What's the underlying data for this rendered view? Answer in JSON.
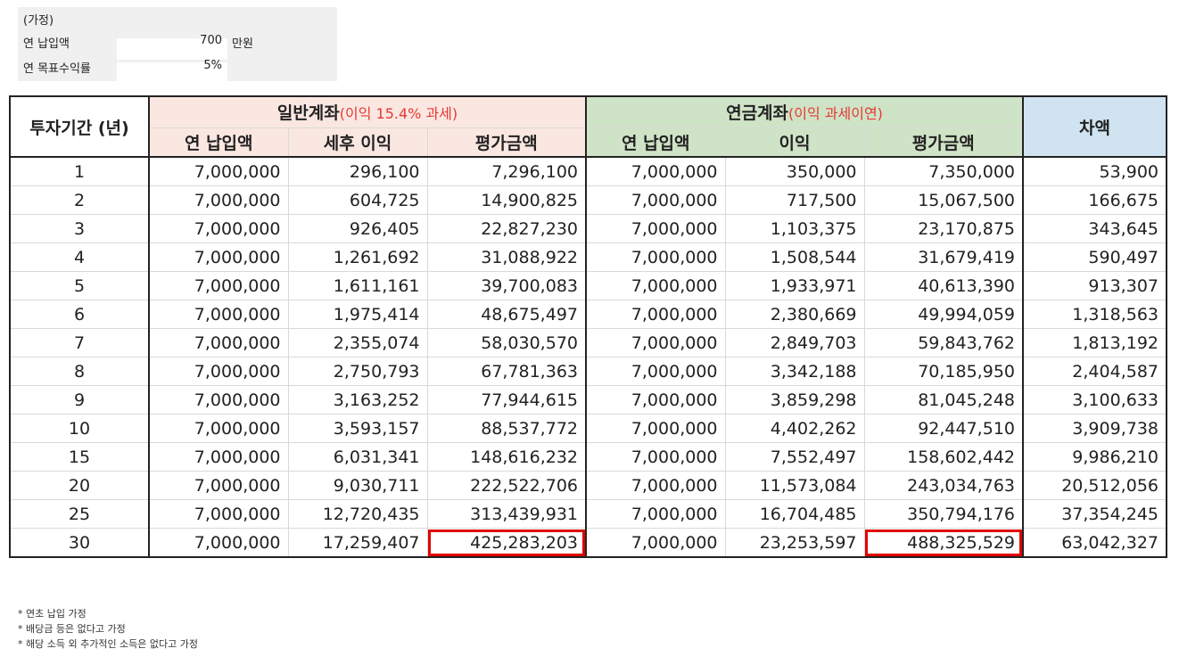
{
  "assumptions": {
    "title": "(가정)",
    "annual_payment_label": "연 납입액",
    "annual_payment_value": "700",
    "unit": "만원",
    "target_return_label": "연 목표수익률",
    "target_return_value": "5%"
  },
  "table": {
    "header_period": "투자기간 (년)",
    "general_title": "일반계좌",
    "general_note": "(이익 15.4% 과세)",
    "pension_title": "연금계좌",
    "pension_note": "(이익 과세이연)",
    "diff_title": "차액",
    "general_cols": [
      "연 납입액",
      "세후 이익",
      "평가금액"
    ],
    "pension_cols": [
      "연 납입액",
      "이익",
      "평가금액"
    ],
    "rows": [
      [
        "1",
        "7,000,000",
        "296,100",
        "7,296,100",
        "7,000,000",
        "350,000",
        "7,350,000",
        "53,900"
      ],
      [
        "2",
        "7,000,000",
        "604,725",
        "14,900,825",
        "7,000,000",
        "717,500",
        "15,067,500",
        "166,675"
      ],
      [
        "3",
        "7,000,000",
        "926,405",
        "22,827,230",
        "7,000,000",
        "1,103,375",
        "23,170,875",
        "343,645"
      ],
      [
        "4",
        "7,000,000",
        "1,261,692",
        "31,088,922",
        "7,000,000",
        "1,508,544",
        "31,679,419",
        "590,497"
      ],
      [
        "5",
        "7,000,000",
        "1,611,161",
        "39,700,083",
        "7,000,000",
        "1,933,971",
        "40,613,390",
        "913,307"
      ],
      [
        "6",
        "7,000,000",
        "1,975,414",
        "48,675,497",
        "7,000,000",
        "2,380,669",
        "49,994,059",
        "1,318,563"
      ],
      [
        "7",
        "7,000,000",
        "2,355,074",
        "58,030,570",
        "7,000,000",
        "2,849,703",
        "59,843,762",
        "1,813,192"
      ],
      [
        "8",
        "7,000,000",
        "2,750,793",
        "67,781,363",
        "7,000,000",
        "3,342,188",
        "70,185,950",
        "2,404,587"
      ],
      [
        "9",
        "7,000,000",
        "3,163,252",
        "77,944,615",
        "7,000,000",
        "3,859,298",
        "81,045,248",
        "3,100,633"
      ],
      [
        "10",
        "7,000,000",
        "3,593,157",
        "88,537,772",
        "7,000,000",
        "4,402,262",
        "92,447,510",
        "3,909,738"
      ],
      [
        "15",
        "7,000,000",
        "6,031,341",
        "148,616,232",
        "7,000,000",
        "7,552,497",
        "158,602,442",
        "9,986,210"
      ],
      [
        "20",
        "7,000,000",
        "9,030,711",
        "222,522,706",
        "7,000,000",
        "11,573,084",
        "243,034,763",
        "20,512,056"
      ],
      [
        "25",
        "7,000,000",
        "12,720,435",
        "313,439,931",
        "7,000,000",
        "16,704,485",
        "350,794,176",
        "37,354,245"
      ],
      [
        "30",
        "7,000,000",
        "17,259,407",
        "425,283,203",
        "7,000,000",
        "23,253,597",
        "488,325,529",
        "63,042,327"
      ]
    ],
    "highlight_row": 13,
    "highlight_cols": [
      3,
      6
    ],
    "highlight_color": "#e00000"
  },
  "notes": [
    "* 연초 납입 가정",
    "* 배당금 등은 없다고 가정",
    "* 해당 소득 외 추가적인 소득은 없다고 가정"
  ]
}
